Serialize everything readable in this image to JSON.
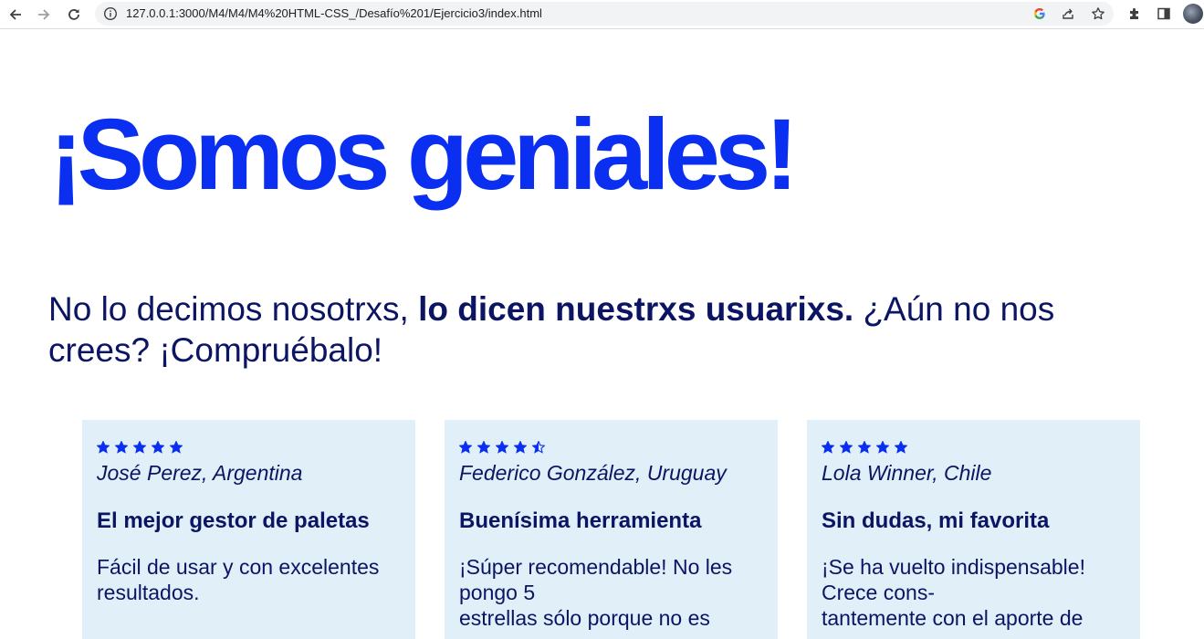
{
  "browser": {
    "url": "127.0.0.1:3000/M4/M4/M4%20HTML-CSS_/Desafío%201/Ejercicio3/index.html",
    "icons": [
      "back-icon",
      "forward-icon",
      "reload-icon",
      "info-icon",
      "google-icon",
      "share-icon",
      "bookmark-star-icon",
      "extensions-icon",
      "side-panel-icon",
      "profile-avatar"
    ]
  },
  "colors": {
    "accent": "#0a2ff0",
    "text": "#0b1563",
    "card_bg": "#e1eff8"
  },
  "hero": {
    "title": "¡Somos geniales!"
  },
  "intro": {
    "part1": "No lo decimos nosotrxs, ",
    "bold": "lo dicen nuestrxs usuarixs.",
    "part2": " ¿Aún no nos crees? ¡Compruébalo!"
  },
  "testimonials": [
    {
      "rating": 5,
      "author": "José Perez, Argentina",
      "title": "El mejor gestor de paletas",
      "lines": [
        "Fácil de usar y con excelentes",
        "resultados."
      ]
    },
    {
      "rating": 4.5,
      "author": "Federico González, Uruguay",
      "title": "Buenísima herramienta",
      "lines": [
        "¡Súper recomendable! No les pongo 5",
        "estrellas sólo porque no es"
      ]
    },
    {
      "rating": 5,
      "author": "Lola Winner, Chile",
      "title": "Sin dudas, mi favorita",
      "lines": [
        "¡Se ha vuelto indispensable! Crece cons-",
        "tantemente con el aporte de"
      ]
    }
  ]
}
